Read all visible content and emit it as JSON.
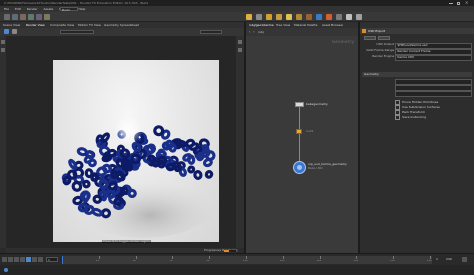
{
  "window": {
    "title": "C:/HOUDINI/Homework/Houdini/RenderTests/001 - Houdini FX Education Edition 19.5.303 - Build"
  },
  "menubar": {
    "items": [
      "File",
      "Edit",
      "Render",
      "Assets",
      "Windows",
      "Help"
    ],
    "desktop_label": "Build"
  },
  "viewport": {
    "tabs": [
      "Scene View",
      "Render View",
      "Composite View",
      "Motion FX View",
      "Geometry Spreadsheet"
    ],
    "status_text": "Press Q to toggle render region",
    "progress_text": "Progressive Rendering",
    "progress_fraction": 0.4
  },
  "network": {
    "tabs": [
      "/obj/geo1/karma",
      "Tree View",
      "Material Palette",
      "Asset Browser"
    ],
    "path_label": "/obj",
    "context_label": "Geometry",
    "nodes": [
      {
        "name": "bakegeometry",
        "kind": "geometry"
      },
      {
        "name": "null1",
        "kind": "null"
      },
      {
        "name": "rop_usd_karma_geometry",
        "kind": "karma",
        "sub": "Bake USD"
      }
    ]
  },
  "parameters": {
    "header": "USD Export",
    "node_name": "rop_USD_karma_geometry",
    "rows": [
      {
        "label": "USD Output",
        "value": "$HIP/usd/karma.usd"
      },
      {
        "label": "Valid Frame Range",
        "value": "Render Current Frame"
      },
      {
        "label": "Render Engine",
        "value": "Karma CPU"
      }
    ],
    "section": "Geometry",
    "checks": [
      "Prune Hidden Primitives",
      "Use Subdivision Surfaces",
      "Pack Transform",
      "Save Instancing"
    ]
  },
  "timeline": {
    "current_frame": "1",
    "start_frame": "1",
    "end_frame": "240",
    "ticks": [
      "24",
      "48",
      "72",
      "96",
      "120",
      "144",
      "168",
      "192",
      "216",
      "240"
    ]
  },
  "colors": {
    "accent_orange": "#e08a2a",
    "node_blue": "#3b78d0",
    "background": "#2b2b2b"
  }
}
